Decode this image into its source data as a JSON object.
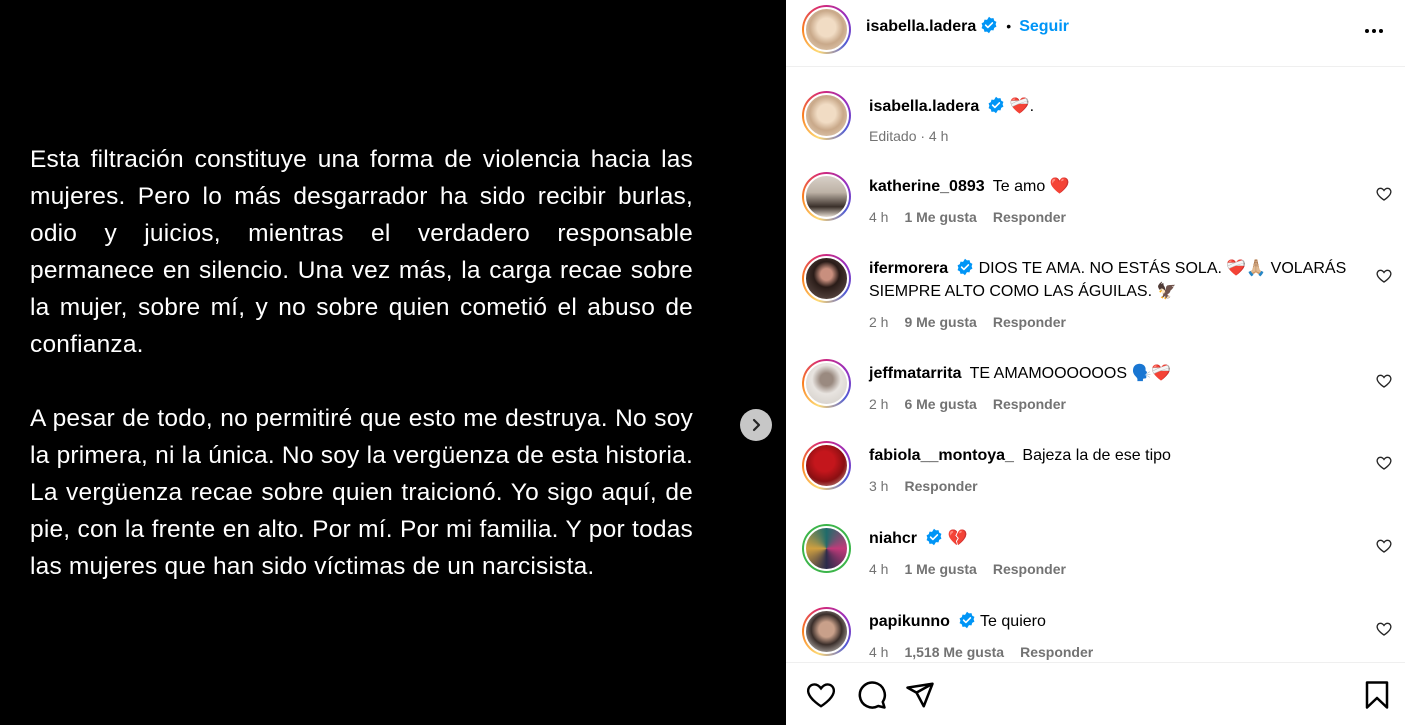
{
  "post": {
    "paragraph1": "Esta filtración constituye una forma de violencia hacia las mujeres. Pero lo más desgarrador ha sido recibir burlas, odio y juicios, mientras el verdadero responsable permanece en silencio. Una vez más, la carga recae sobre la mujer, sobre mí, y no sobre quien cometió el abuso de confianza.",
    "paragraph2": "A pesar de todo, no permitiré que esto me destruya. No soy la primera, ni la única. No soy la vergüenza de esta historia. La vergüenza recae sobre quien traicionó. Yo sigo aquí, de pie, con la frente en alto. Por mí. Por mi familia. Y por todas las mujeres que han sido víctimas de un narcisista."
  },
  "header": {
    "username": "isabella.ladera",
    "dot": "•",
    "follow": "Seguir"
  },
  "caption": {
    "username": "isabella.ladera",
    "text": "❤️‍🩹.",
    "meta": "Editado · 4 h"
  },
  "comments": [
    {
      "username": "katherine_0893",
      "text": "Te amo ❤️",
      "time": "4 h",
      "likes": "1 Me gusta",
      "reply": "Responder"
    },
    {
      "username": "ifermorera",
      "text": "DIOS TE AMA. NO ESTÁS SOLA. ❤️‍🩹🙏🏼 VOLARÁS SIEMPRE ALTO COMO LAS ÁGUILAS. 🦅",
      "time": "2 h",
      "likes": "9 Me gusta",
      "reply": "Responder"
    },
    {
      "username": "jeffmatarrita",
      "text": "TE AMAMOOOOOOS 🗣️❤️‍🩹",
      "time": "2 h",
      "likes": "6 Me gusta",
      "reply": "Responder"
    },
    {
      "username": "fabiola__montoya_",
      "text": "Bajeza la de ese tipo",
      "time": "3 h",
      "likes": "",
      "reply": "Responder"
    },
    {
      "username": "niahcr",
      "text": "💔",
      "time": "4 h",
      "likes": "1 Me gusta",
      "reply": "Responder"
    },
    {
      "username": "papikunno",
      "text": "Te quiero",
      "time": "4 h",
      "likes": "1,518 Me gusta",
      "reply": "Responder"
    }
  ],
  "colors": {
    "accent": "#0095f6",
    "verified": "#0095f6",
    "muted": "#737373",
    "story_ring_green": "#3cb54a"
  },
  "icons": [
    "chevron-right-icon",
    "more-icon",
    "verified-icon",
    "heart-icon",
    "comment-icon",
    "share-icon",
    "bookmark-icon"
  ]
}
